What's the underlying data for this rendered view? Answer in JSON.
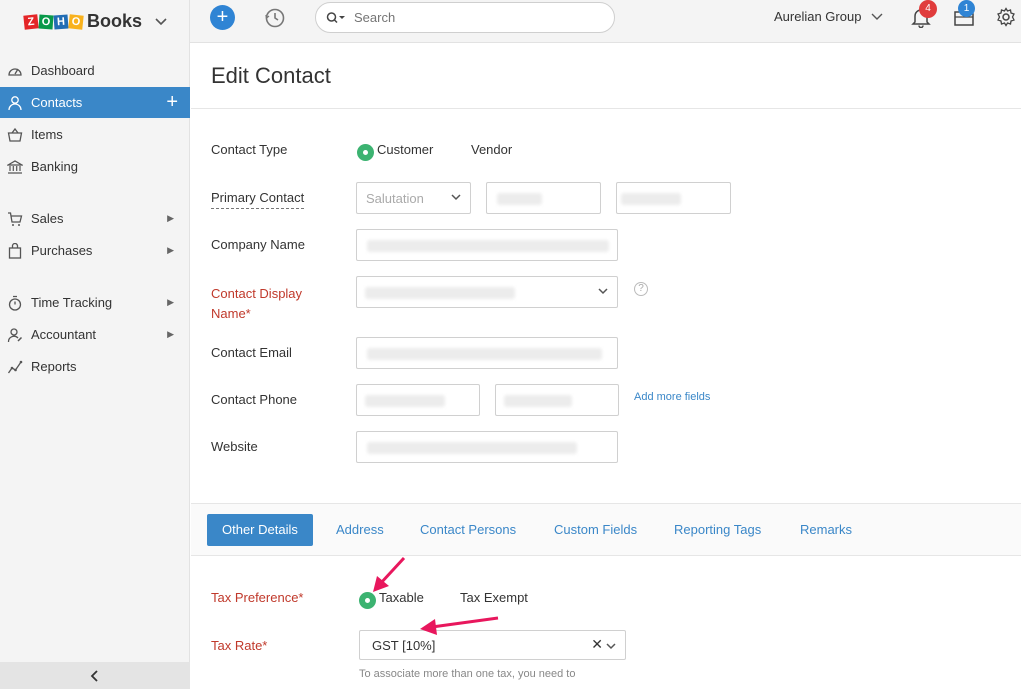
{
  "brand": {
    "logo_text": "ZOHO",
    "name": "Books"
  },
  "topbar": {
    "search_placeholder": "Search",
    "org_name": "Aurelian Group",
    "notifications_count": "4",
    "inbox_count": "1"
  },
  "sidebar": {
    "items": [
      {
        "label": "Dashboard",
        "icon": "dashboard-icon"
      },
      {
        "label": "Contacts",
        "icon": "contact-icon",
        "active": true
      },
      {
        "label": "Items",
        "icon": "basket-icon"
      },
      {
        "label": "Banking",
        "icon": "bank-icon"
      },
      {
        "label": "Sales",
        "icon": "cart-icon"
      },
      {
        "label": "Purchases",
        "icon": "bag-icon"
      },
      {
        "label": "Time Tracking",
        "icon": "stopwatch-icon"
      },
      {
        "label": "Accountant",
        "icon": "accountant-icon"
      },
      {
        "label": "Reports",
        "icon": "reports-icon"
      }
    ]
  },
  "page": {
    "title": "Edit Contact"
  },
  "form": {
    "contact_type_label": "Contact Type",
    "customer_label": "Customer",
    "vendor_label": "Vendor",
    "primary_contact_label": "Primary Contact",
    "salutation_placeholder": "Salutation",
    "company_name_label": "Company Name",
    "display_name_label_1": "Contact Display",
    "display_name_label_2": "Name*",
    "email_label": "Contact Email",
    "phone_label": "Contact Phone",
    "add_more_fields": "Add more fields",
    "website_label": "Website",
    "help_glyph": "?"
  },
  "tabs": [
    "Other Details",
    "Address",
    "Contact Persons",
    "Custom Fields",
    "Reporting Tags",
    "Remarks"
  ],
  "other_details": {
    "tax_preference_label": "Tax Preference*",
    "taxable_label": "Taxable",
    "tax_exempt_label": "Tax Exempt",
    "tax_rate_label": "Tax Rate*",
    "tax_rate_value": "GST [10%]",
    "note": "To associate more than one tax, you need to"
  },
  "colors": {
    "accent": "#3a87c8",
    "required": "#c0392b",
    "radio": "#3cb371",
    "annotation": "#e8175d"
  }
}
